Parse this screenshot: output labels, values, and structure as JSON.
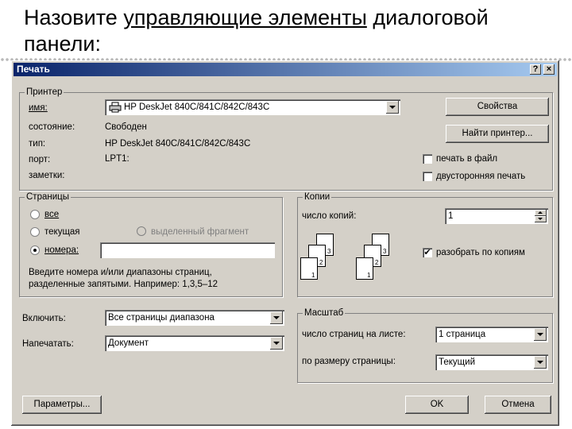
{
  "slide": {
    "title_part1": "Назовите ",
    "title_underlined": "управляющие элементы",
    "title_part2": " диалоговой панели:"
  },
  "dialog": {
    "title": "Печать",
    "help_button": "?",
    "close_button": "×",
    "printer": {
      "group_label": "Принтер",
      "name_label": "имя:",
      "name_value": "HP DeskJet 840C/841C/842C/843C",
      "status_label": "состояние:",
      "status_value": "Свободен",
      "type_label": "тип:",
      "type_value": "HP DeskJet 840C/841C/842C/843C",
      "port_label": "порт:",
      "port_value": "LPT1:",
      "notes_label": "заметки:",
      "properties_button": "Свойства",
      "find_printer_button": "Найти принтер...",
      "print_to_file_label": "печать в файл",
      "duplex_label": "двусторонняя печать"
    },
    "pages": {
      "group_label": "Страницы",
      "all_label": "все",
      "current_label": "текущая",
      "selection_label": "выделенный фрагмент",
      "numbers_label": "номера:",
      "numbers_value": "",
      "hint_line1": "Введите номера и/или диапазоны страниц,",
      "hint_line2": "разделенные запятыми. Например: 1,3,5–12"
    },
    "copies": {
      "group_label": "Копии",
      "count_label": "число копий:",
      "count_value": "1",
      "collate_label": "разобрать по копиям",
      "collate_checked": true,
      "page_numbers": [
        "1",
        "2",
        "3"
      ]
    },
    "include": {
      "label": "Включить:",
      "value": "Все страницы диапазона"
    },
    "print_what": {
      "label": "Напечатать:",
      "value": "Документ"
    },
    "scale": {
      "group_label": "Масштаб",
      "pages_per_sheet_label": "число страниц на листе:",
      "pages_per_sheet_value": "1 страница",
      "fit_to_label": "по размеру страницы:",
      "fit_to_value": "Текущий"
    },
    "options_button": "Параметры...",
    "ok_button": "OK",
    "cancel_button": "Отмена"
  }
}
